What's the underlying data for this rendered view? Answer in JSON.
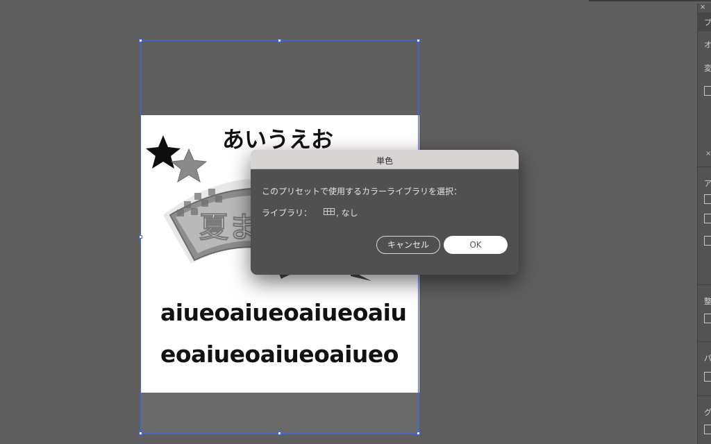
{
  "artboard": {
    "heading": "あいうえお",
    "banner_text": "夏ま",
    "line1": "aiueoaiueoaiueoaiu",
    "line2": "eoaiueoaiueoaiueo"
  },
  "dialog": {
    "title": "単色",
    "message": "このプリセットで使用するカラーライブラリを選択：",
    "library_label": "ライブラリ：",
    "library_icon": "swatch-library-icon",
    "library_value": ", なし",
    "cancel_label": "キャンセル",
    "ok_label": "OK"
  },
  "right_panel": {
    "close_glyph": "×",
    "header_char": "プ",
    "labels": [
      "オ",
      "変",
      "ア",
      "整",
      "パ",
      "グ"
    ],
    "collapse_glyph": "×"
  },
  "colors": {
    "canvas": "#5f5f5f",
    "selection": "#4a64c8",
    "dialog_body": "#505050",
    "dialog_titlebar": "#d7d4d3"
  }
}
